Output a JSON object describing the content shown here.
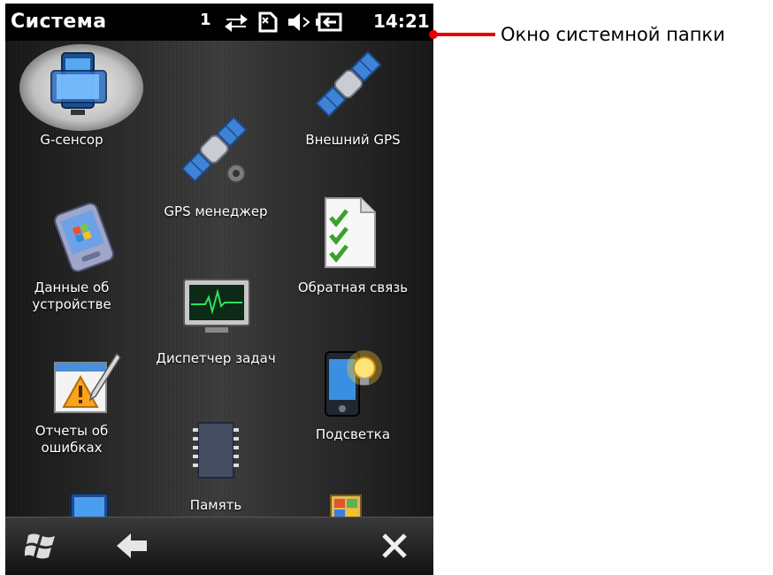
{
  "status_bar": {
    "title": "Система",
    "signal": "1",
    "time": "14:21",
    "icons": [
      "data-sync-icon",
      "sim-icon",
      "volume-muted-icon",
      "battery-charging-icon"
    ]
  },
  "apps": [
    {
      "label": "G-сенсор",
      "icon": "g-sensor-icon"
    },
    {
      "label": "Внешний GPS",
      "icon": "satellite-icon"
    },
    {
      "label": "GPS менеджер",
      "icon": "satellite-gear-icon"
    },
    {
      "label": "Данные об\nустройстве",
      "icon": "device-info-icon"
    },
    {
      "label": "Обратная связь",
      "icon": "checklist-document-icon"
    },
    {
      "label": "Диспетчер задач",
      "icon": "task-manager-monitor-icon"
    },
    {
      "label": "Отчеты об\nошибках",
      "icon": "error-report-icon"
    },
    {
      "label": "Подсветка",
      "icon": "backlight-icon"
    },
    {
      "label": "Память",
      "icon": "memory-chip-icon"
    }
  ],
  "partial_icons": [
    "screen-icon",
    "window-icon"
  ],
  "bottom_bar": [
    "windows-start-icon",
    "back-arrow-icon",
    "close-icon"
  ],
  "callout": {
    "text": "Окно системной папки"
  },
  "colors": {
    "callout_line": "#e60000",
    "glow": "#ffffff",
    "icon_blue": "#3b8fe0"
  }
}
